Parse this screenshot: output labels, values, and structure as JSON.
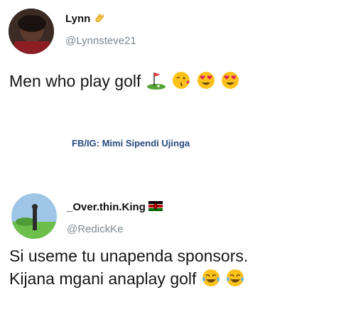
{
  "tweets": [
    {
      "name": "Lynn",
      "handle": "@Lynnsteve21",
      "text": "Men who play golf",
      "name_emoji_icon": "waving-hand-icon",
      "text_emojis": [
        "golf-flag-icon",
        "face-blowing-kiss-icon",
        "heart-eyes-icon",
        "heart-eyes-icon"
      ]
    },
    {
      "name": "_Over.thin.King",
      "handle": "@RedickKe",
      "text_lines": [
        "Si useme tu unapenda sponsors.",
        "Kijana mgani anaplay golf"
      ],
      "name_emoji_icon": "kenya-flag-icon",
      "text_emojis": [
        "tears-of-joy-icon",
        "tears-of-joy-icon"
      ]
    }
  ],
  "credit": "FB/IG: Mimi Sipendi Ujinga",
  "colors": {
    "credit": "#26497d",
    "handle": "#7d8891",
    "text": "#161616"
  }
}
